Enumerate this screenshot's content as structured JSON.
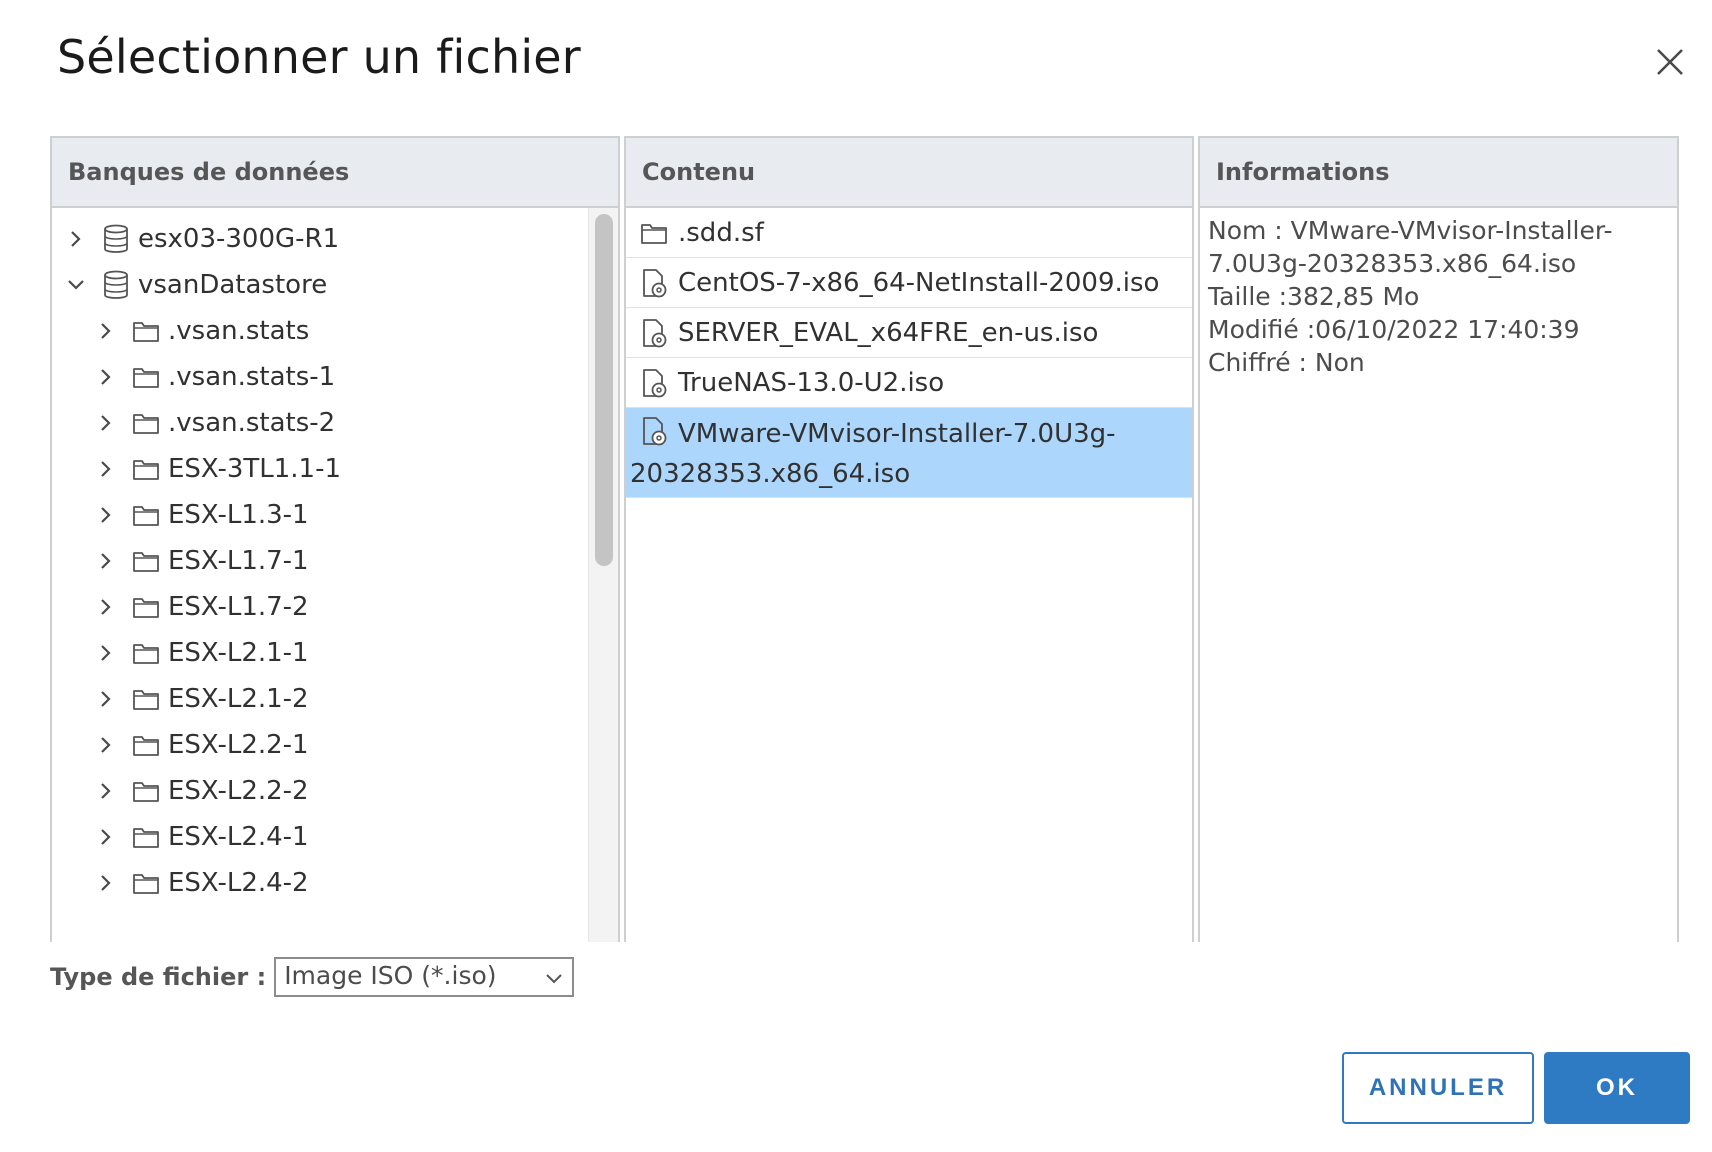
{
  "dialog": {
    "title": "Sélectionner un fichier"
  },
  "datastores": {
    "header": "Banques de données",
    "items": [
      {
        "label": "esx03-300G-R1",
        "type": "datastore",
        "expanded": false,
        "level": 0
      },
      {
        "label": "vsanDatastore",
        "type": "datastore",
        "expanded": true,
        "level": 0
      },
      {
        "label": ".vsan.stats",
        "type": "folder",
        "expanded": false,
        "level": 1
      },
      {
        "label": ".vsan.stats-1",
        "type": "folder",
        "expanded": false,
        "level": 1
      },
      {
        "label": ".vsan.stats-2",
        "type": "folder",
        "expanded": false,
        "level": 1
      },
      {
        "label": "ESX-3TL1.1-1",
        "type": "folder",
        "expanded": false,
        "level": 1
      },
      {
        "label": "ESX-L1.3-1",
        "type": "folder",
        "expanded": false,
        "level": 1
      },
      {
        "label": "ESX-L1.7-1",
        "type": "folder",
        "expanded": false,
        "level": 1
      },
      {
        "label": "ESX-L1.7-2",
        "type": "folder",
        "expanded": false,
        "level": 1
      },
      {
        "label": "ESX-L2.1-1",
        "type": "folder",
        "expanded": false,
        "level": 1
      },
      {
        "label": "ESX-L2.1-2",
        "type": "folder",
        "expanded": false,
        "level": 1
      },
      {
        "label": "ESX-L2.2-1",
        "type": "folder",
        "expanded": false,
        "level": 1
      },
      {
        "label": "ESX-L2.2-2",
        "type": "folder",
        "expanded": false,
        "level": 1
      },
      {
        "label": "ESX-L2.4-1",
        "type": "folder",
        "expanded": false,
        "level": 1
      },
      {
        "label": "ESX-L2.4-2",
        "type": "folder",
        "expanded": false,
        "level": 1
      }
    ]
  },
  "contents": {
    "header": "Contenu",
    "items": [
      {
        "label": ".sdd.sf",
        "type": "folder",
        "selected": false
      },
      {
        "label": "CentOS-7-x86_64-NetInstall-2009.iso",
        "type": "iso",
        "selected": false
      },
      {
        "label": "SERVER_EVAL_x64FRE_en-us.iso",
        "type": "iso",
        "selected": false
      },
      {
        "label": "TrueNAS-13.0-U2.iso",
        "type": "iso",
        "selected": false
      },
      {
        "label": "VMware-VMvisor-Installer-7.0U3g-20328353.x86_64.iso",
        "type": "iso",
        "selected": true
      }
    ]
  },
  "info": {
    "header": "Informations",
    "lines": [
      "Nom : VMware-VMvisor-Installer-7.0U3g-20328353.x86_64.iso",
      "Taille :382,85 Mo",
      "Modifié :06/10/2022 17:40:39",
      "Chiffré : Non"
    ]
  },
  "filetype": {
    "label": "Type de fichier :",
    "selected": "Image ISO (*.iso)"
  },
  "buttons": {
    "cancel": "ANNULER",
    "ok": "OK"
  },
  "colors": {
    "selection": "#acd6fb",
    "header_bg": "#e8ebef",
    "primary": "#2e7bc4"
  }
}
